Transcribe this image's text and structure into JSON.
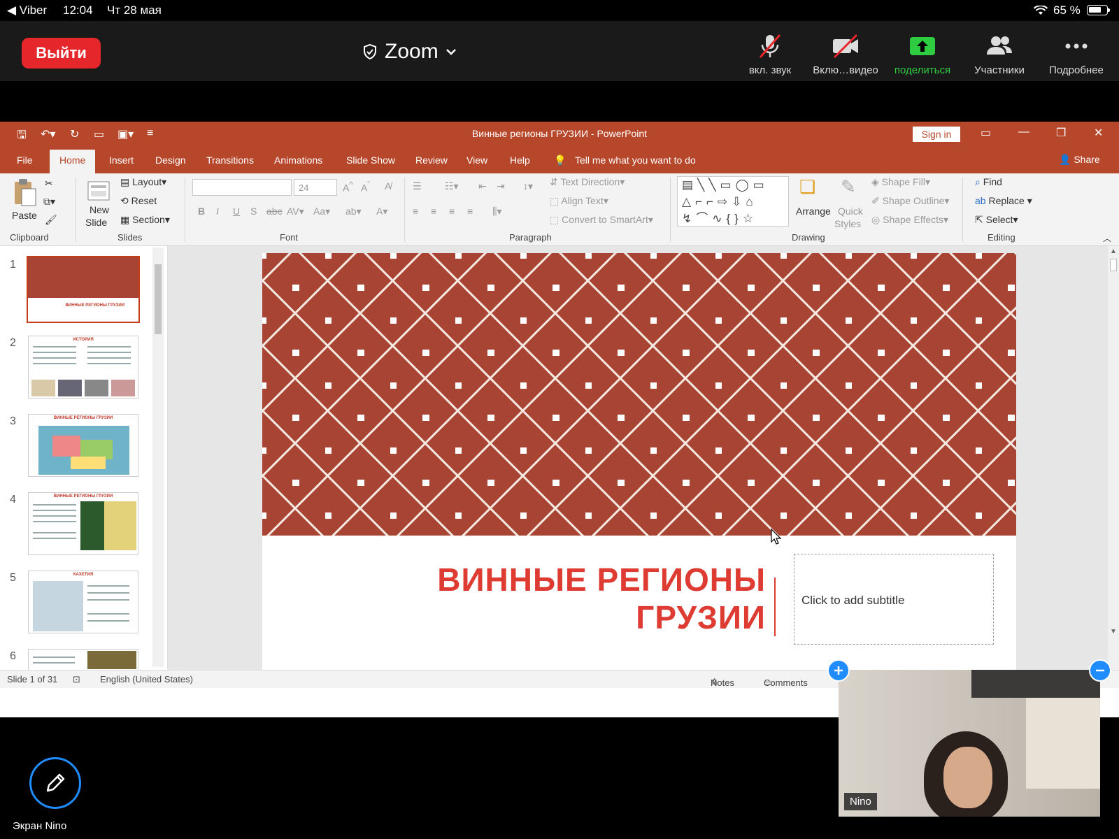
{
  "status_bar": {
    "back_app": "◀ Viber",
    "time": "12:04",
    "date": "Чт 28 мая",
    "battery": "65 %"
  },
  "zoom": {
    "leave_label": "Выйти",
    "meeting_title": "Zoom",
    "tools": {
      "mute": "вкл. звук",
      "video": "Вклю…видео",
      "share": "поделиться",
      "participants": "Участники",
      "more": "Подробнее"
    },
    "screen_owner_label": "Экран Nino",
    "participant_name": "Nino"
  },
  "powerpoint": {
    "window_title": "Винные регионы ГРУЗИИ  -  PowerPoint",
    "sign_in": "Sign in",
    "tabs": [
      "File",
      "Home",
      "Insert",
      "Design",
      "Transitions",
      "Animations",
      "Slide Show",
      "Review",
      "View",
      "Help"
    ],
    "active_tab": "Home",
    "tell_me": "Tell me what you want to do",
    "share": "Share",
    "ribbon": {
      "clipboard": {
        "paste": "Paste",
        "label": "Clipboard"
      },
      "slides": {
        "new_slide": "New",
        "new_slide2": "Slide",
        "layout": "Layout",
        "reset": "Reset",
        "section": "Section",
        "label": "Slides"
      },
      "font": {
        "size": "24",
        "label": "Font"
      },
      "paragraph": {
        "text_direction": "Text Direction",
        "align_text": "Align Text",
        "convert_smartart": "Convert to SmartArt",
        "label": "Paragraph"
      },
      "drawing": {
        "arrange": "Arrange",
        "quick_styles": "Quick",
        "quick_styles2": "Styles",
        "shape_fill": "Shape Fill",
        "shape_outline": "Shape Outline",
        "shape_effects": "Shape Effects",
        "label": "Drawing"
      },
      "editing": {
        "find": "Find",
        "replace": "Replace",
        "select": "Select",
        "label": "Editing"
      }
    },
    "thumbnails": [
      {
        "num": "1",
        "title": "ВИННЫЕ РЕГИОНЫ ГРУЗИИ"
      },
      {
        "num": "2",
        "title": "ИСТОРИЯ"
      },
      {
        "num": "3",
        "title": "ВИННЫЕ РЕГИОНЫ ГРУЗИИ"
      },
      {
        "num": "4",
        "title": "ВИННЫЕ РЕГИОНЫ ГРУЗИИ"
      },
      {
        "num": "5",
        "title": "КАХЕТИЯ"
      },
      {
        "num": "6",
        "title": ""
      }
    ],
    "slide": {
      "title_line1": "ВИННЫЕ  РЕГИОНЫ",
      "title_line2": "ГРУЗИИ",
      "subtitle_placeholder": "Click to add subtitle"
    },
    "status": {
      "slide_count": "Slide 1 of 31",
      "language": "English (United States)",
      "notes": "Notes",
      "comments": "Comments"
    }
  },
  "colors": {
    "ppt_accent": "#b7472a",
    "slide_pattern": "#a84434",
    "zoom_leave": "#e5272b",
    "zoom_share": "#2ecc40",
    "zoom_blue": "#1f8cff"
  }
}
